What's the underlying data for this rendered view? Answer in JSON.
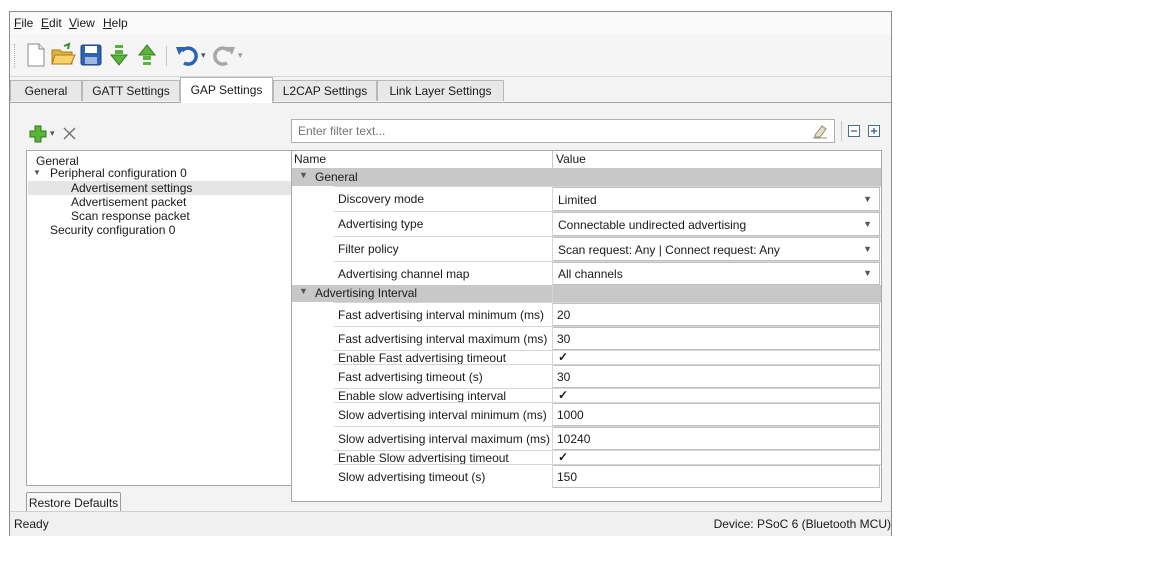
{
  "menu": [
    {
      "label": "File",
      "u": "F",
      "rest": "ile"
    },
    {
      "label": "Edit",
      "u": "E",
      "rest": "dit"
    },
    {
      "label": "View",
      "u": "V",
      "rest": "iew"
    },
    {
      "label": "Help",
      "u": "H",
      "rest": "elp"
    }
  ],
  "toolbar": {
    "icons": [
      "new-file-icon",
      "open-folder-icon",
      "save-icon",
      "import-icon",
      "export-icon",
      "undo-icon",
      "redo-icon"
    ]
  },
  "tabs": [
    "General",
    "GATT Settings",
    "GAP Settings",
    "L2CAP Settings",
    "Link Layer Settings"
  ],
  "active_tab": "GAP Settings",
  "tree": [
    {
      "label": "General"
    },
    {
      "label": "Peripheral configuration 0"
    },
    {
      "label": "Advertisement settings"
    },
    {
      "label": "Advertisement packet"
    },
    {
      "label": "Scan response packet"
    },
    {
      "label": "Security configuration 0"
    }
  ],
  "restore_label": "Restore Defaults",
  "filter_placeholder": "Enter filter text...",
  "grid": {
    "col_name": "Name",
    "col_value": "Value",
    "cat_general": "General",
    "cat_adv": "Advertising Interval",
    "general_rows": [
      {
        "name": "Discovery mode",
        "value": "Limited"
      },
      {
        "name": "Advertising type",
        "value": "Connectable undirected advertising"
      },
      {
        "name": "Filter policy",
        "value": "Scan request: Any | Connect request: Any"
      },
      {
        "name": "Advertising channel map",
        "value": "All channels"
      }
    ],
    "adv_rows": [
      {
        "name": "Fast advertising interval minimum (ms)",
        "value": "20"
      },
      {
        "name": "Fast advertising interval maximum (ms)",
        "value": "30"
      },
      {
        "name": "Enable Fast advertising timeout",
        "value": "✓"
      },
      {
        "name": "Fast advertising timeout (s)",
        "value": "30"
      },
      {
        "name": "Enable slow advertising interval",
        "value": "✓"
      },
      {
        "name": "Slow advertising interval minimum (ms)",
        "value": "1000"
      },
      {
        "name": "Slow advertising interval maximum (ms)",
        "value": "10240"
      },
      {
        "name": "Enable Slow advertising timeout",
        "value": "✓"
      },
      {
        "name": "Slow advertising timeout (s)",
        "value": "150"
      }
    ]
  },
  "status": {
    "left": "Ready",
    "right": "Device: PSoC 6 (Bluetooth MCU)"
  }
}
